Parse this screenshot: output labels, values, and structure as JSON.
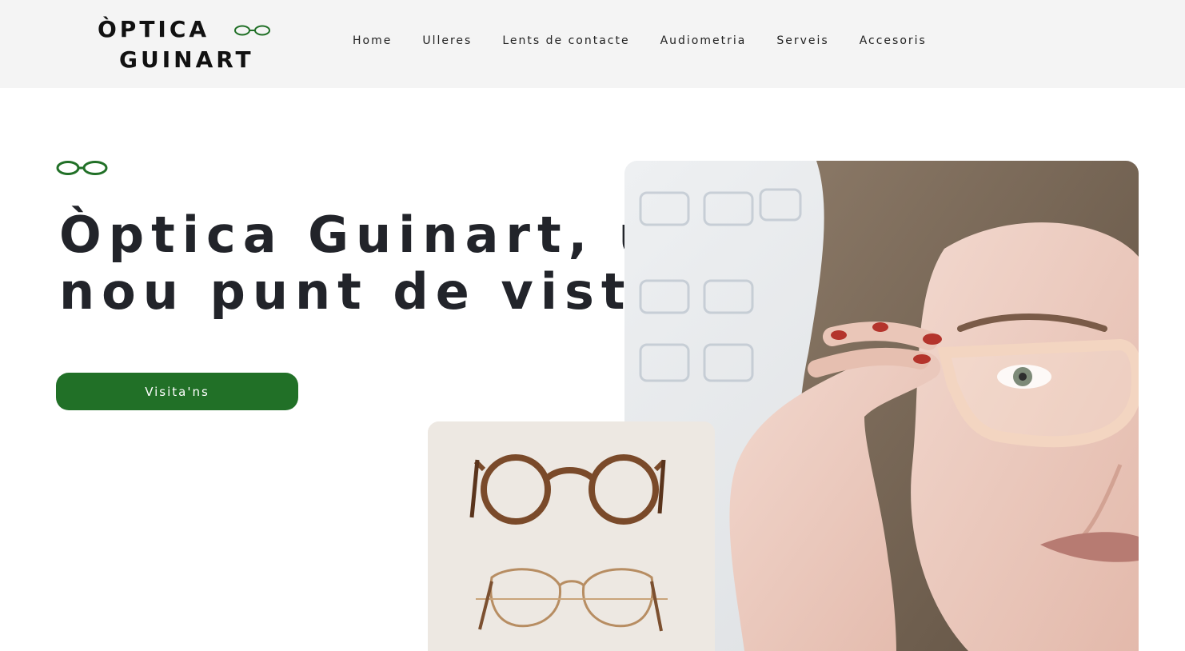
{
  "brand": {
    "line1": "ÒPTICA",
    "line2": "GUINART",
    "accent_color": "#217027",
    "logo_icon": "glasses-icon"
  },
  "nav": {
    "items": [
      {
        "label": "Home"
      },
      {
        "label": "Ulleres"
      },
      {
        "label": "Lents de contacte"
      },
      {
        "label": "Audiometria"
      },
      {
        "label": "Serveis"
      },
      {
        "label": "Accesoris"
      }
    ]
  },
  "hero": {
    "icon": "glasses-icon",
    "title_line1": "Òptica Guinart, un",
    "title_line2": "nou punt de vista",
    "cta_label": "Visita'ns"
  },
  "images": {
    "main": "woman-adjusting-glasses-photo",
    "secondary": "two-pairs-of-glasses-photo"
  }
}
